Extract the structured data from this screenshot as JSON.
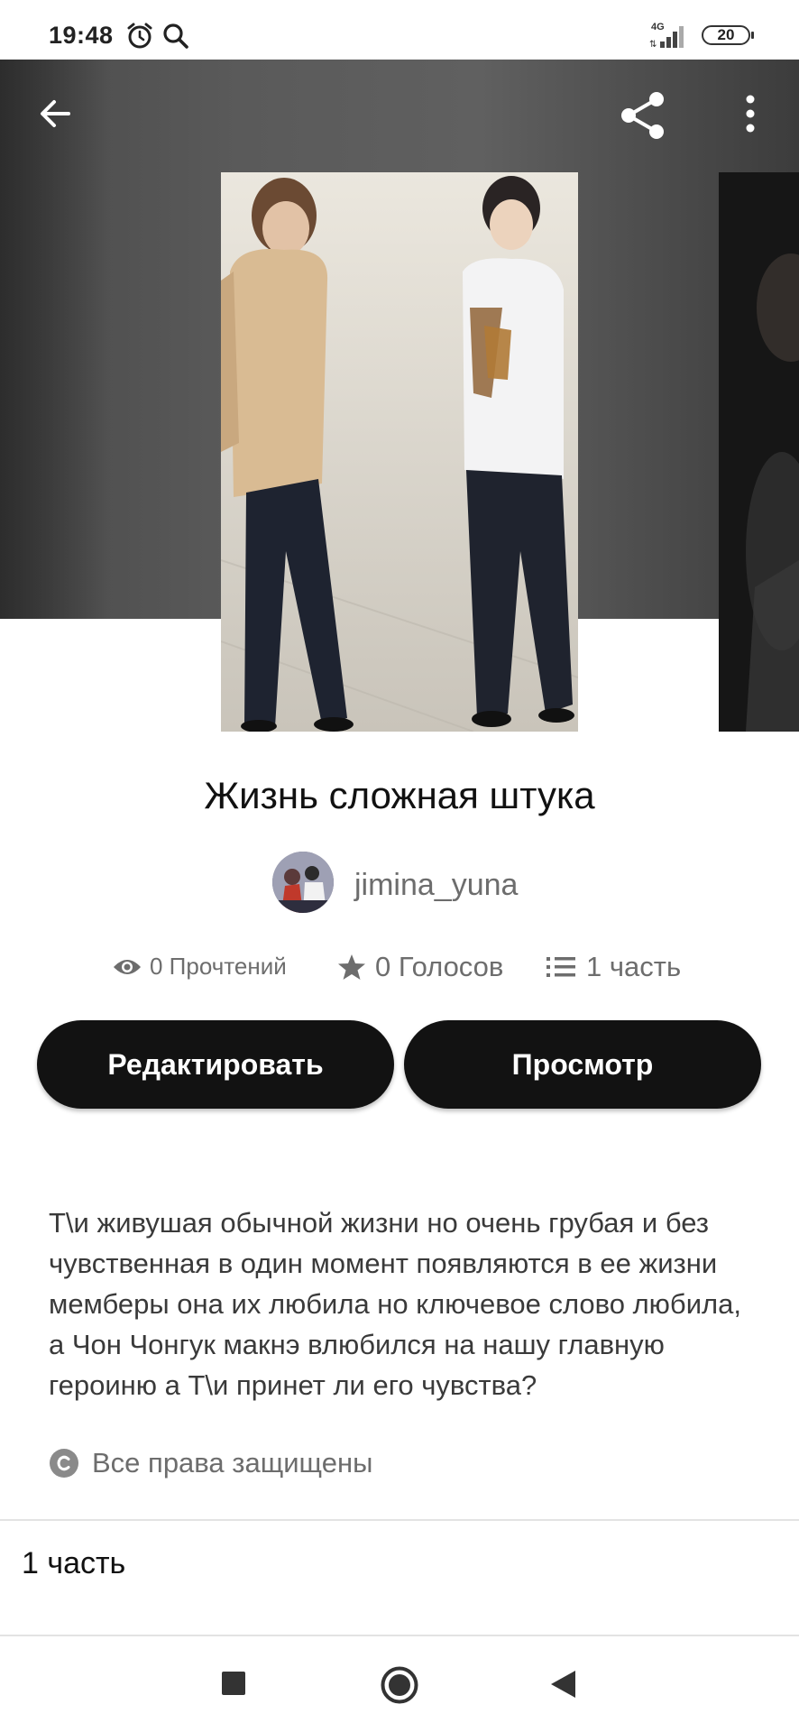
{
  "status_bar": {
    "time": "19:48",
    "network": "4G",
    "battery": "20"
  },
  "toolbar": {
    "back_icon": "arrow-left-icon",
    "share_icon": "share-icon",
    "menu_icon": "more-vertical-icon"
  },
  "story": {
    "title": "Жизнь сложная штука",
    "author": "jimina_yuna",
    "stats": {
      "reads": "0 Прочтений",
      "votes": "0 Голосов",
      "parts": "1 часть"
    },
    "edit_button": "Редактировать",
    "view_button": "Просмотр",
    "description": "Т\\и живушая обычной жизни но очень грубая и без чувственная в один момент появляются в ее жизни мемберы она их любила но ключевое слово любила, а Чон Чонгук макнэ влюбился на нашу главную героиню а Т\\и принет ли его чувства?",
    "rights": "Все права защищены"
  },
  "chapters": [
    {
      "label": "1 часть"
    }
  ],
  "colors": {
    "button_bg": "#121212",
    "secondary_text": "#6d6d6d"
  }
}
